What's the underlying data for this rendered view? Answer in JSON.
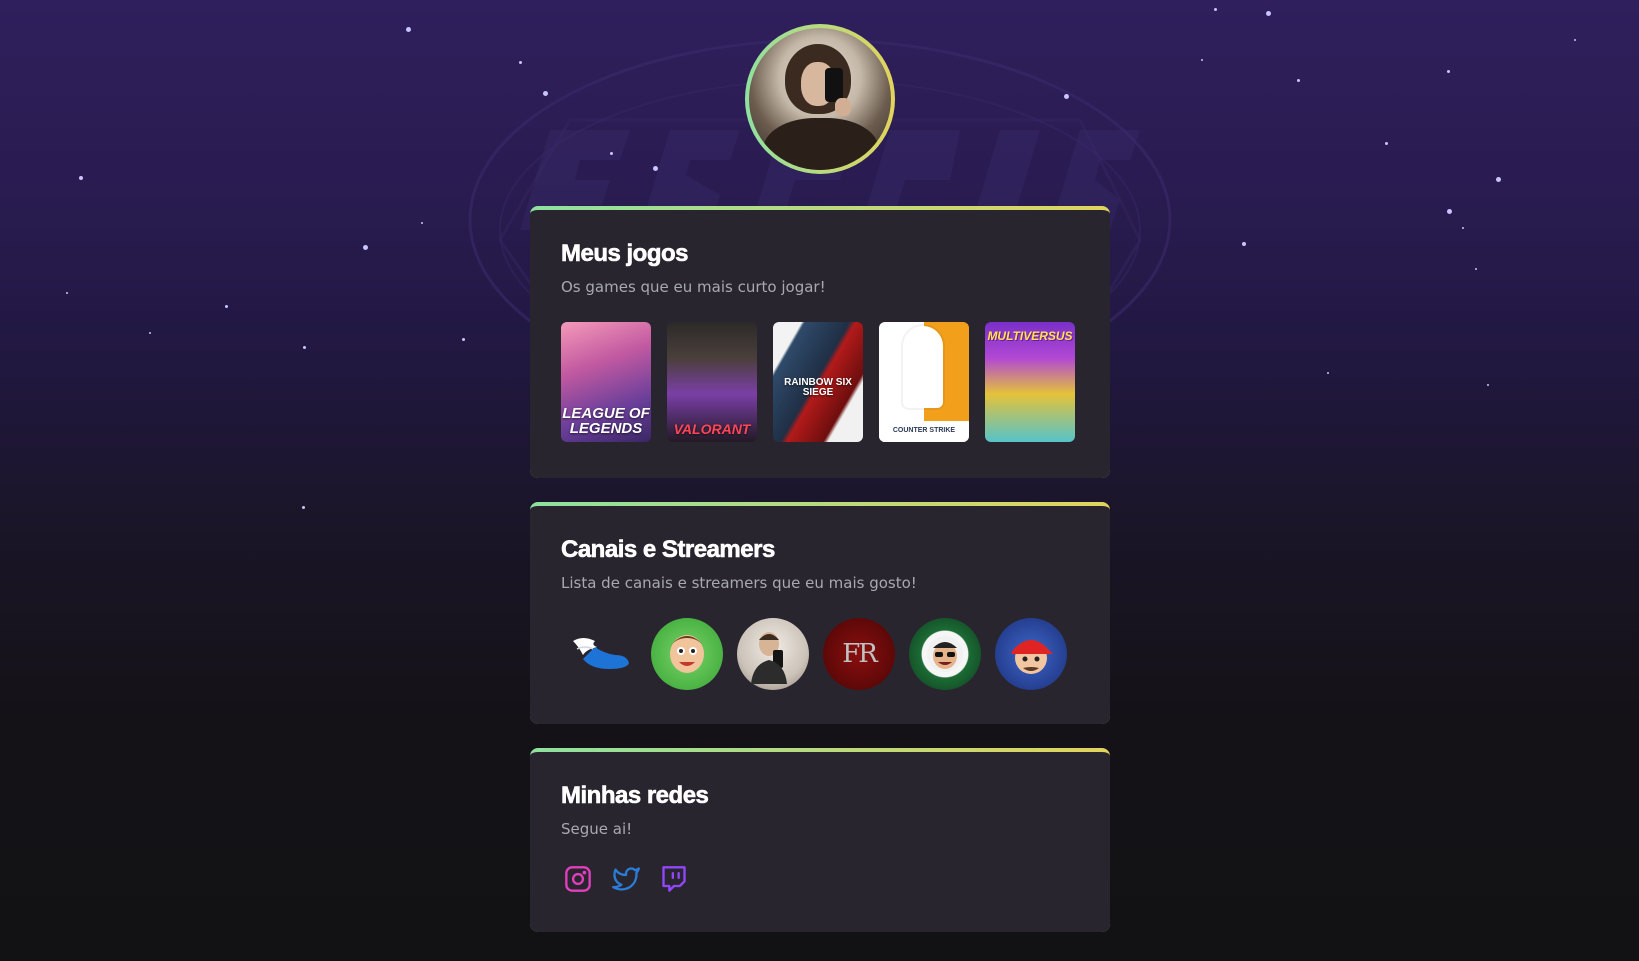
{
  "profile": {
    "avatar_icon": "profile-avatar"
  },
  "games_section": {
    "title": "Meus jogos",
    "subtitle": "Os games que eu mais curto jogar!",
    "games": [
      {
        "label": "LEAGUE OF LEGENDS"
      },
      {
        "label": "VALORANT"
      },
      {
        "label": "RAINBOW SIX SIEGE"
      },
      {
        "label": "COUNTER STRIKE"
      },
      {
        "label": "MULTIVERSUS"
      }
    ]
  },
  "streamers_section": {
    "title": "Canais e Streamers",
    "subtitle": "Lista de canais e streamers que eu mais gosto!",
    "streamers": [
      {
        "icon": "winged-shoe-icon"
      },
      {
        "icon": "cartoon-avatar-icon"
      },
      {
        "icon": "selfie-avatar-icon"
      },
      {
        "icon": "fr-logo-icon",
        "text": "FR"
      },
      {
        "icon": "casimiro-badge-icon"
      },
      {
        "icon": "red-cap-avatar-icon"
      }
    ]
  },
  "socials_section": {
    "title": "Minhas redes",
    "subtitle": "Segue ai!",
    "links": [
      {
        "icon": "instagram-icon",
        "color": "#e23fbf"
      },
      {
        "icon": "twitter-icon",
        "color": "#2a7dd6"
      },
      {
        "icon": "twitch-icon",
        "color": "#9147ff"
      }
    ]
  },
  "colors": {
    "card_bg": "#29252f",
    "accent_gradient_start": "#8fe1a0",
    "accent_gradient_end": "#e2d45c",
    "subtitle_text": "#a8a8b3"
  }
}
